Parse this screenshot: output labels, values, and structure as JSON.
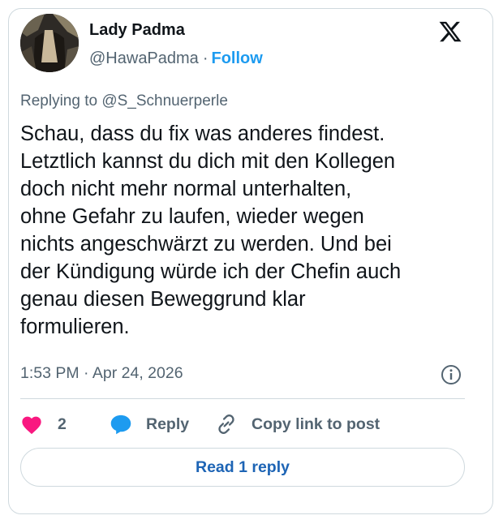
{
  "author": {
    "display_name": "Lady Padma",
    "handle": "@HawaPadma",
    "separator": "·",
    "follow_label": "Follow"
  },
  "reply_context": {
    "prefix": "Replying to ",
    "mention": "@S_Schnuerperle"
  },
  "tweet": {
    "lines": [
      "Schau, dass du fix was anderes findest.",
      "Letztlich kannst du dich mit den Kollegen",
      "doch nicht mehr normal unterhalten,",
      "ohne Gefahr zu laufen, wieder wegen",
      "nichts angeschwärzt zu werden. Und bei",
      "der Kündigung würde ich der Chefin auch",
      "genau diesen Beweggrund klar",
      "formulieren."
    ],
    "timestamp": "1:53 PM · Apr 24, 2026"
  },
  "actions": {
    "like_count": "2",
    "reply_label": "Reply",
    "copy_link_label": "Copy link to post"
  },
  "read_replies_label": "Read 1 reply",
  "colors": {
    "like_pink": "#f91880",
    "reply_blue": "#1d9bf0",
    "follow_blue": "#1d9bf0",
    "muted_gray": "#536471"
  }
}
